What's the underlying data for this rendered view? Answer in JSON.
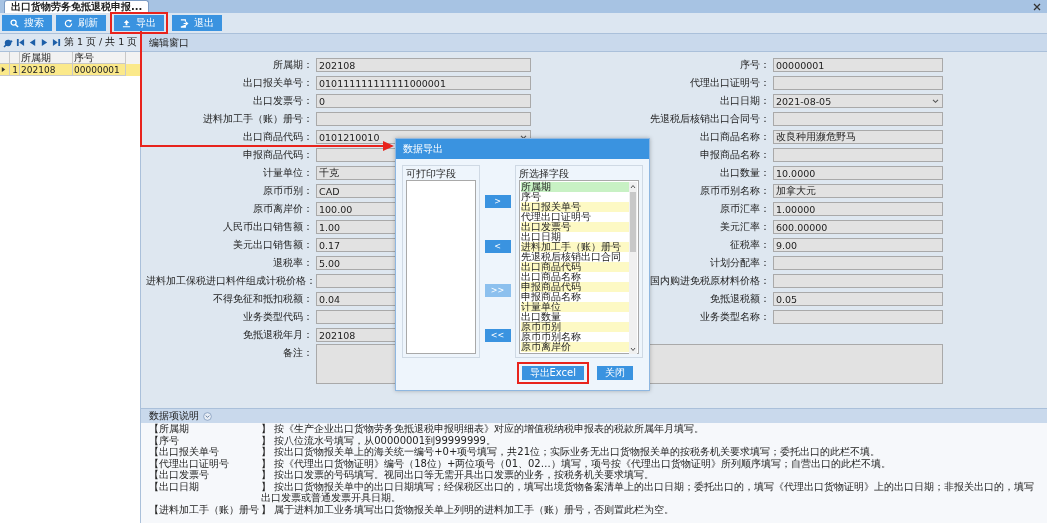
{
  "tab": {
    "title": "出口货物劳务免抵退税申报..."
  },
  "toolbar": [
    {
      "label": "搜索"
    },
    {
      "label": "刷新"
    },
    {
      "label": "导出"
    },
    {
      "label": "退出"
    }
  ],
  "pager": {
    "text": "第 1 页 / 共 1 页"
  },
  "grid": {
    "columns": [
      "所属期",
      "序号"
    ],
    "rows": [
      {
        "number": "1",
        "cells": [
          "202108",
          "00000001"
        ],
        "selected": true
      }
    ]
  },
  "editor": {
    "title": "编辑窗口",
    "rows": [
      {
        "left": {
          "label": "所属期：",
          "value": "202108",
          "kind": "text"
        },
        "right": {
          "label": "序号：",
          "value": "00000001",
          "kind": "text"
        }
      },
      {
        "left": {
          "label": "出口报关单号：",
          "value": "010111111111111000001",
          "kind": "text"
        },
        "right": {
          "label": "代理出口证明号：",
          "kind": "text"
        }
      },
      {
        "left": {
          "label": "出口发票号：",
          "value": "0",
          "kind": "text"
        },
        "right": {
          "label": "出口日期：",
          "value": "2021-08-05",
          "kind": "select"
        }
      },
      {
        "left": {
          "label": "进料加工手（账）册号：",
          "kind": "text"
        },
        "right": {
          "label": "先退税后核销出口合同号：",
          "kind": "text"
        }
      },
      {
        "left": {
          "label": "出口商品代码：",
          "value": "0101210010",
          "kind": "select"
        },
        "right": {
          "label": "出口商品名称：",
          "value": "改良种用濒危野马",
          "kind": "text"
        }
      },
      {
        "left": {
          "label": "申报商品代码：",
          "kind": "text"
        },
        "right": {
          "label": "申报商品名称：",
          "kind": "text"
        }
      },
      {
        "left": {
          "label": "计量单位：",
          "value": "千克",
          "kind": "text"
        },
        "right": {
          "label": "出口数量：",
          "value": "10.0000",
          "kind": "text"
        }
      },
      {
        "left": {
          "label": "原币币别：",
          "value": "CAD",
          "kind": "text"
        },
        "right": {
          "label": "原币币别名称：",
          "value": "加拿大元",
          "kind": "text"
        }
      },
      {
        "left": {
          "label": "原币离岸价：",
          "value": "100.00",
          "kind": "text"
        },
        "right": {
          "label": "原币汇率：",
          "value": "1.00000",
          "kind": "text"
        }
      },
      {
        "left": {
          "label": "人民币出口销售额：",
          "value": "1.00",
          "kind": "text"
        },
        "right": {
          "label": "美元汇率：",
          "value": "600.00000",
          "kind": "text"
        }
      },
      {
        "left": {
          "label": "美元出口销售额：",
          "value": "0.17",
          "kind": "text"
        },
        "right": {
          "label": "征税率：",
          "value": "9.00",
          "kind": "text"
        }
      },
      {
        "left": {
          "label": "退税率：",
          "value": "5.00",
          "kind": "text"
        },
        "right": {
          "label": "计划分配率：",
          "kind": "text"
        }
      },
      {
        "left": {
          "label": "进料加工保税进口料件组成计税价格：",
          "kind": "text"
        },
        "right": {
          "label": "国内购进免税原材料价格：",
          "kind": "text"
        }
      },
      {
        "left": {
          "label": "不得免征和抵扣税额：",
          "value": "0.04",
          "kind": "text"
        },
        "right": {
          "label": "免抵退税额：",
          "value": "0.05",
          "kind": "text"
        }
      },
      {
        "left": {
          "label": "业务类型代码：",
          "kind": "text"
        },
        "right": {
          "label": "业务类型名称：",
          "kind": "text"
        }
      },
      {
        "left": {
          "label": "免抵退税年月：",
          "value": "202108",
          "kind": "text"
        }
      }
    ],
    "remarks": {
      "label": "备注："
    }
  },
  "dialog": {
    "title": "数据导出",
    "available": {
      "legend": "可打印字段"
    },
    "chosen": {
      "legend": "所选择字段",
      "items": [
        {
          "label": "所属期",
          "selected": true
        },
        {
          "label": "序号",
          "selected": false
        },
        {
          "label": "出口报关单号",
          "selected": false
        },
        {
          "label": "代理出口证明号",
          "selected": false
        },
        {
          "label": "出口发票号",
          "selected": false
        },
        {
          "label": "出口日期",
          "selected": false
        },
        {
          "label": "进料加工手（账）册号",
          "selected": false
        },
        {
          "label": "先退税后核销出口合同",
          "selected": false
        },
        {
          "label": "出口商品代码",
          "selected": false
        },
        {
          "label": "出口商品名称",
          "selected": false
        },
        {
          "label": "申报商品代码",
          "selected": false
        },
        {
          "label": "申报商品名称",
          "selected": false
        },
        {
          "label": "计量单位",
          "selected": false
        },
        {
          "label": "出口数量",
          "selected": false
        },
        {
          "label": "原币币别",
          "selected": false
        },
        {
          "label": "原币币别名称",
          "selected": false
        },
        {
          "label": "原币离岸价",
          "selected": false
        }
      ]
    },
    "moves": [
      {
        "label": ">",
        "disabled": false
      },
      {
        "label": "<",
        "disabled": false
      },
      {
        "label": ">>",
        "disabled": true
      },
      {
        "label": "<<",
        "disabled": false
      }
    ],
    "actions": [
      "导出Excel",
      "关闭"
    ]
  },
  "notes": {
    "title": "数据项说明",
    "rows": [
      {
        "name": "【所属期",
        "text": "】 按《生产企业出口货物劳务免抵退税申报明细表》对应的增值税纳税申报表的税款所属年月填写。"
      },
      {
        "name": "【序号",
        "text": "】 按八位流水号填写，从00000001到99999999。"
      },
      {
        "name": "【出口报关单号",
        "text": "】 按出口货物报关单上的海关统一编号+0+项号填写，共21位；实际业务无出口货物报关单的按税务机关要求填写；委托出口的此栏不填。"
      },
      {
        "name": "【代理出口证明号",
        "text": "】 按《代理出口货物证明》编号（18位）+两位项号（01、02…）填写，项号按《代理出口货物证明》所列顺序填写；自营出口的此栏不填。"
      },
      {
        "name": "【出口发票号",
        "text": "】 按出口发票的号码填写。视同出口等无需开具出口发票的业务，按税务机关要求填写。"
      },
      {
        "name": "【出口日期",
        "text": "】 按出口货物报关单中的出口日期填写；经保税区出口的，填写出境货物备案清单上的出口日期；委托出口的，填写《代理出口货物证明》上的出口日期；非报关出口的，填写出口发票或普通发票开具日期。"
      },
      {
        "name": "【进料加工手（账）册号",
        "text": "】 属于进料加工业务填写出口货物报关单上列明的进料加工手（账）册号，否则置此栏为空。"
      }
    ]
  }
}
